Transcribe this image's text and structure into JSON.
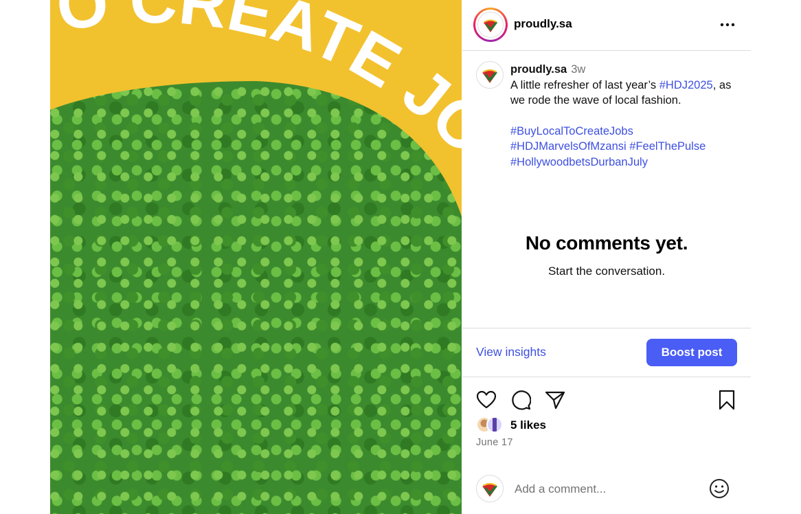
{
  "media": {
    "banner_text": "TO CREATE JO",
    "colors": {
      "banner": "#f2c12e",
      "banner_text": "#ffffff",
      "foliage": "#3c8a2e"
    }
  },
  "header": {
    "username": "proudly.sa",
    "more_icon": "more-horizontal-icon"
  },
  "caption": {
    "username": "proudly.sa",
    "time": "3w",
    "line1": "A little refresher of last year’s",
    "hashtag1": "#HDJ2025",
    "line2": ", as we rode the wave of local fashion.",
    "hashtag2": "#BuyLocalToCreateJobs",
    "hashtag3": "#HDJMarvelsOfMzansi",
    "hashtag4": "#FeelThePulse",
    "hashtag5": "#HollywoodbetsDurbanJuly"
  },
  "comments": {
    "empty_title": "No comments yet.",
    "empty_subtitle": "Start the conversation."
  },
  "actions_bar": {
    "insights_label": "View insights",
    "boost_label": "Boost post"
  },
  "icons": [
    "heart-icon",
    "comment-icon",
    "share-icon",
    "bookmark-icon",
    "emoji-icon"
  ],
  "likes": {
    "text": "5 likes"
  },
  "post_date": "June 17",
  "comment_box": {
    "placeholder": "Add a comment..."
  },
  "colors": {
    "link": "#3d4fe0",
    "button": "#4a5df5",
    "secondary_text": "#737373",
    "separator": "#dbdbdb"
  }
}
